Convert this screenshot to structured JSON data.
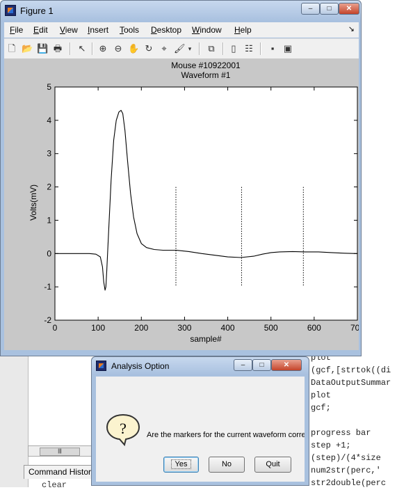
{
  "figure_window": {
    "title": "Figure 1",
    "controls": {
      "minimize": "–",
      "maximize": "□",
      "close": "✕"
    },
    "menu": [
      "File",
      "Edit",
      "View",
      "Insert",
      "Tools",
      "Desktop",
      "Window",
      "Help"
    ],
    "menu_accelerators": [
      "F",
      "E",
      "V",
      "I",
      "T",
      "D",
      "W",
      "H"
    ],
    "toolbar_icons": [
      "new-figure-icon",
      "open-icon",
      "save-icon",
      "print-icon",
      "edit-plot-arrow-icon",
      "zoom-in-icon",
      "zoom-out-icon",
      "pan-hand-icon",
      "rotate-3d-icon",
      "data-cursor-icon",
      "brush-icon",
      "link-plot-icon",
      "colorbar-icon",
      "legend-icon",
      "hide-plot-tools-icon",
      "show-plot-tools-icon"
    ]
  },
  "chart_data": {
    "type": "line",
    "title": "Mouse #10922001",
    "subtitle": "Waveform #1",
    "xlabel": "sample#",
    "ylabel": "Volts(mV)",
    "xlim": [
      0,
      700
    ],
    "ylim": [
      -2,
      5
    ],
    "xticks": [
      0,
      100,
      200,
      300,
      400,
      500,
      600,
      700
    ],
    "yticks": [
      -2,
      -1,
      0,
      1,
      2,
      3,
      4,
      5
    ],
    "grid": false,
    "line_color": "#000000",
    "series": [
      {
        "x": [
          0,
          40,
          80,
          95,
          105,
          110,
          113,
          116,
          118,
          120,
          124,
          130,
          136,
          142,
          148,
          153,
          157,
          162,
          168,
          175,
          182,
          190,
          200,
          212,
          230,
          250,
          280,
          310,
          340,
          370,
          400,
          430,
          460,
          480,
          500,
          520,
          550,
          580,
          610,
          640,
          670,
          700
        ],
        "y": [
          0,
          0,
          0,
          -0.02,
          -0.1,
          -0.4,
          -0.85,
          -1.1,
          -1.0,
          -0.5,
          0.6,
          2.2,
          3.4,
          4.0,
          4.25,
          4.3,
          4.2,
          3.7,
          2.8,
          1.8,
          1.1,
          0.6,
          0.3,
          0.18,
          0.12,
          0.1,
          0.1,
          0.06,
          0.0,
          -0.05,
          -0.1,
          -0.12,
          -0.08,
          -0.02,
          0.03,
          0.05,
          0.06,
          0.05,
          0.05,
          0.03,
          0.01,
          0.0
        ]
      }
    ],
    "markers": {
      "style": "dotted",
      "x": [
        280,
        432,
        575
      ],
      "y_range": [
        -1,
        2
      ]
    }
  },
  "dialog": {
    "title": "Analysis Option",
    "message": "Are the markers for the current waveform correct?",
    "icon": "question-icon",
    "buttons": {
      "yes": "Yes",
      "no": "No",
      "quit": "Quit"
    },
    "controls": {
      "minimize": "–",
      "maximize": "□",
      "close": "✕"
    }
  },
  "background_editor": {
    "code_lines": [
      "plot",
      "(gcf,[strtok((di",
      "DataOutputSummar",
      "plot",
      "gcf;",
      "",
      "progress bar",
      "step +1;",
      "(step)/(4*size",
      "num2str(perc,'",
      "str2double(perc"
    ],
    "command_history_tab": "Command History",
    "command_history_line": "clear"
  }
}
